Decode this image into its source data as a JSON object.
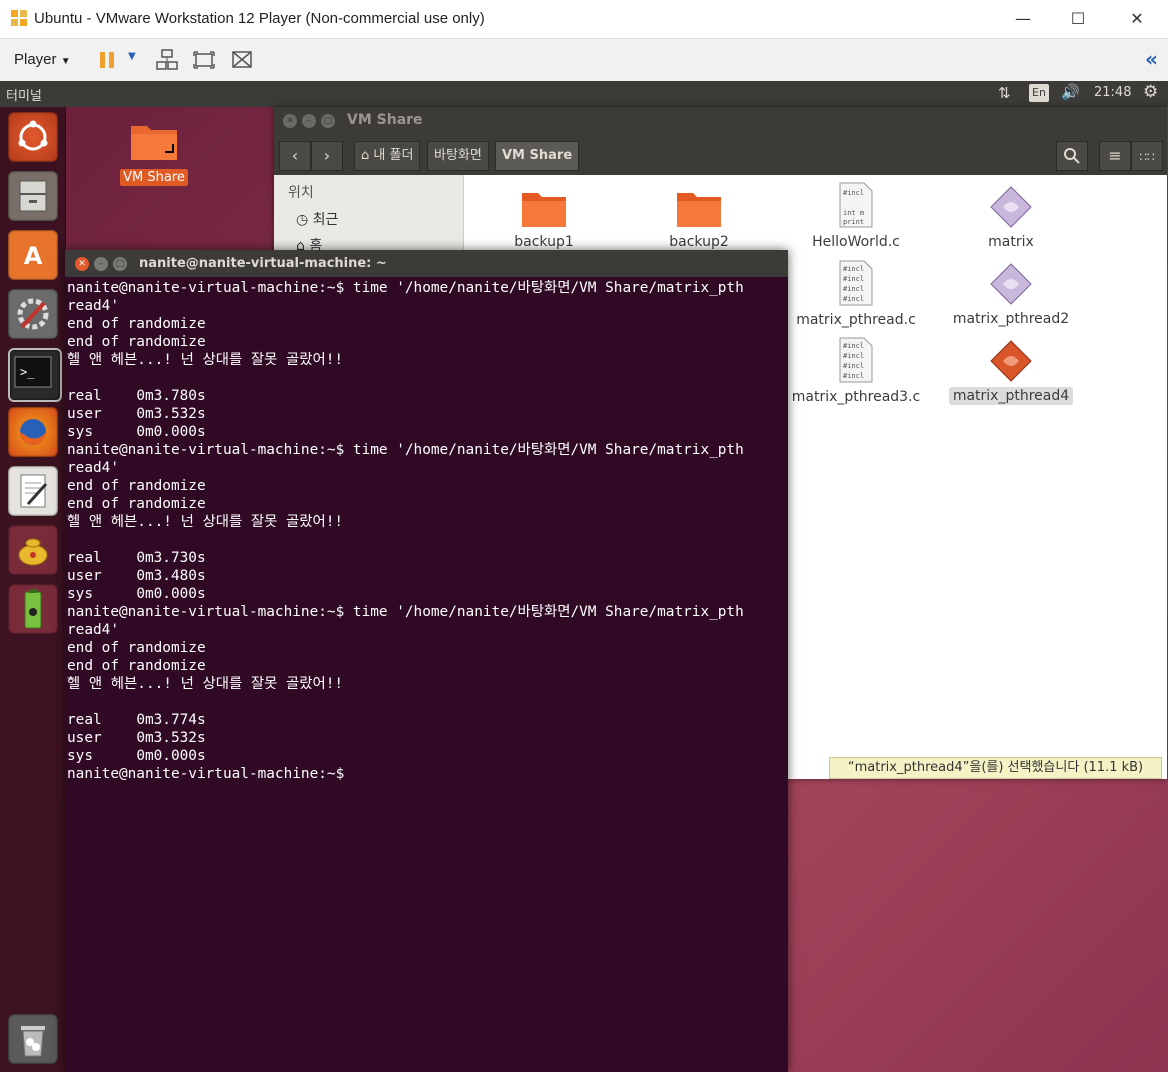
{
  "host_window": {
    "title": "Ubuntu - VMware Workstation 12 Player (Non-commercial use only)",
    "minimize": "—",
    "maximize": "☐",
    "close": "✕"
  },
  "vm_toolbar": {
    "player_label": "Player",
    "collapse_glyph": "«"
  },
  "ubuntu_panel": {
    "app_title": "터미널",
    "keyboard": "En",
    "time": "21:48"
  },
  "desktop_icon": {
    "label": "VM Share"
  },
  "nautilus": {
    "title": "VM Share",
    "breadcrumbs": [
      "내 폴더",
      "바탕화면",
      "VM Share"
    ],
    "sidebar_header": "위치",
    "sidebar_items": [
      "최근",
      "홈"
    ],
    "files": [
      {
        "name": "backup1",
        "kind": "folder"
      },
      {
        "name": "backup2",
        "kind": "folder"
      },
      {
        "name": "HelloWorld.c",
        "kind": "c-source"
      },
      {
        "name": "matrix",
        "kind": "executable"
      },
      {
        "name": "matrix_pthread.c",
        "kind": "c-source"
      },
      {
        "name": "matrix_pthread2",
        "kind": "executable"
      },
      {
        "name": "matrix_pthread3.c",
        "kind": "c-source"
      },
      {
        "name": "matrix_pthread4",
        "kind": "executable-selected"
      }
    ],
    "status": "“matrix_pthread4”을(를) 선택했습니다 (11.1 kB)"
  },
  "terminal": {
    "title": "nanite@nanite-virtual-machine: ~",
    "output": "nanite@nanite-virtual-machine:~$ time '/home/nanite/바탕화면/VM Share/matrix_pth\nread4'\nend of randomize\nend of randomize\n헬 앤 헤븐...! 넌 상대를 잘못 골랐어!!\n\nreal\t0m3.780s\nuser\t0m3.532s\nsys\t0m0.000s\nnanite@nanite-virtual-machine:~$ time '/home/nanite/바탕화면/VM Share/matrix_pth\nread4'\nend of randomize\nend of randomize\n헬 앤 헤븐...! 넌 상대를 잘못 골랐어!!\n\nreal\t0m3.730s\nuser\t0m3.480s\nsys\t0m0.000s\nnanite@nanite-virtual-machine:~$ time '/home/nanite/바탕화면/VM Share/matrix_pth\nread4'\nend of randomize\nend of randomize\n헬 앤 헤븐...! 넌 상대를 잘못 골랐어!!\n\nreal\t0m3.774s\nuser\t0m3.532s\nsys\t0m0.000s\nnanite@nanite-virtual-machine:~$ "
  },
  "launcher_items": [
    "ubuntu-dash",
    "files",
    "software-center",
    "system-settings",
    "terminal",
    "firefox",
    "text-editor",
    "teapot-app",
    "battery-bug-app",
    "trash"
  ]
}
